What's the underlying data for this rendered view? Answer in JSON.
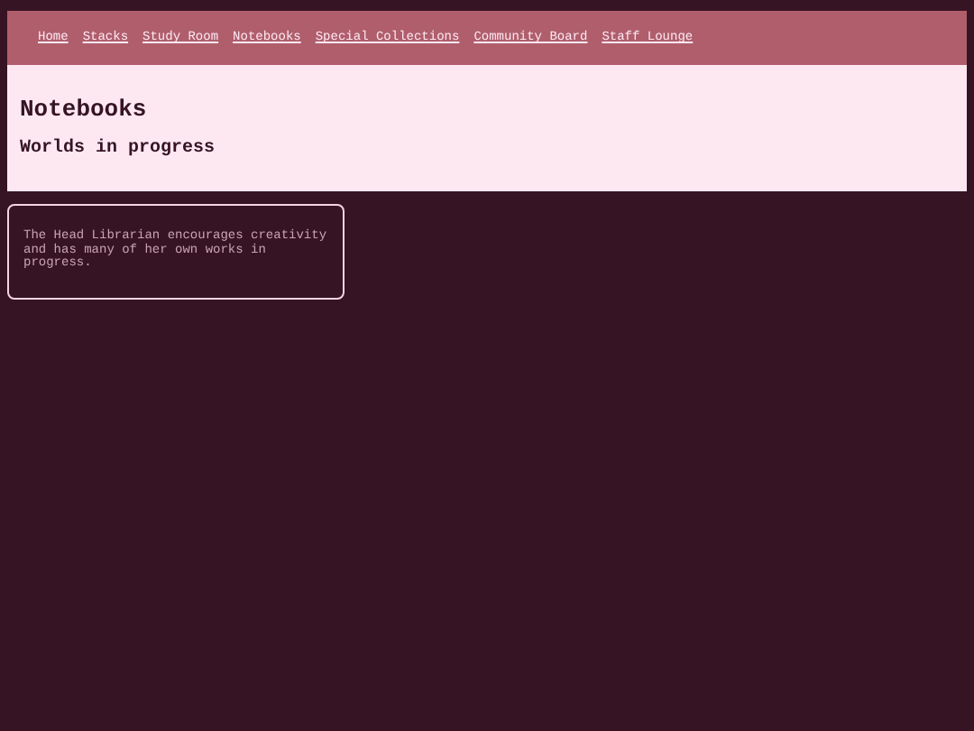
{
  "nav": {
    "links": [
      "Home",
      "Stacks",
      "Study Room",
      "Notebooks",
      "Special Collections",
      "Community Board",
      "Staff Lounge"
    ]
  },
  "header": {
    "title": "Notebooks",
    "subtitle": "Worlds in progress"
  },
  "card": {
    "text": "The Head Librarian encourages creativity and has many of her own works in progress."
  }
}
